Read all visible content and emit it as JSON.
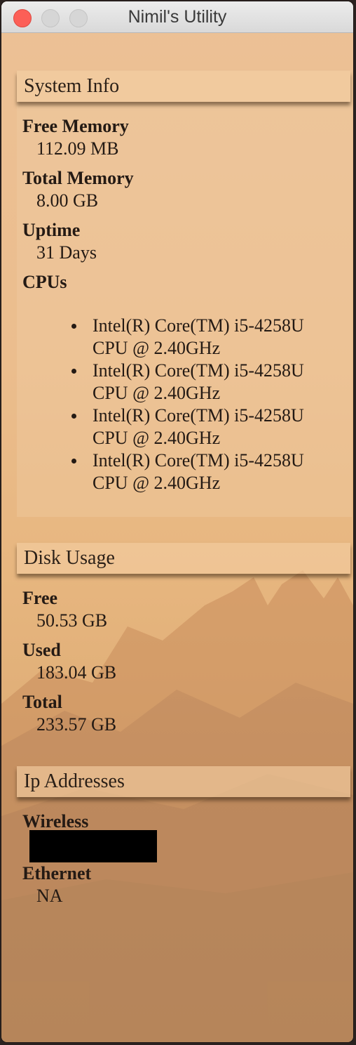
{
  "window": {
    "title": "Nimil's Utility"
  },
  "system_info": {
    "header": "System Info",
    "free_memory": {
      "label": "Free Memory",
      "value": "112.09 MB"
    },
    "total_memory": {
      "label": "Total Memory",
      "value": "8.00 GB"
    },
    "uptime": {
      "label": "Uptime",
      "value": "31 Days"
    },
    "cpus": {
      "label": "CPUs",
      "items": [
        {
          "line1": "Intel(R) Core(TM) i5-4258U",
          "line2": "CPU @ 2.40GHz"
        },
        {
          "line1": "Intel(R) Core(TM) i5-4258U",
          "line2": "CPU @ 2.40GHz"
        },
        {
          "line1": "Intel(R) Core(TM) i5-4258U",
          "line2": "CPU @ 2.40GHz"
        },
        {
          "line1": "Intel(R) Core(TM) i5-4258U",
          "line2": "CPU @ 2.40GHz"
        }
      ]
    }
  },
  "disk_usage": {
    "header": "Disk Usage",
    "free": {
      "label": "Free",
      "value": "50.53 GB"
    },
    "used": {
      "label": "Used",
      "value": "183.04 GB"
    },
    "total": {
      "label": "Total",
      "value": "233.57 GB"
    }
  },
  "ip_addresses": {
    "header": "Ip Addresses",
    "wireless": {
      "label": "Wireless"
    },
    "ethernet": {
      "label": "Ethernet",
      "value": "NA"
    }
  },
  "colors": {
    "close": "#fc5f57",
    "inactive_button": "#d6d6d6",
    "text": "#241a14"
  }
}
